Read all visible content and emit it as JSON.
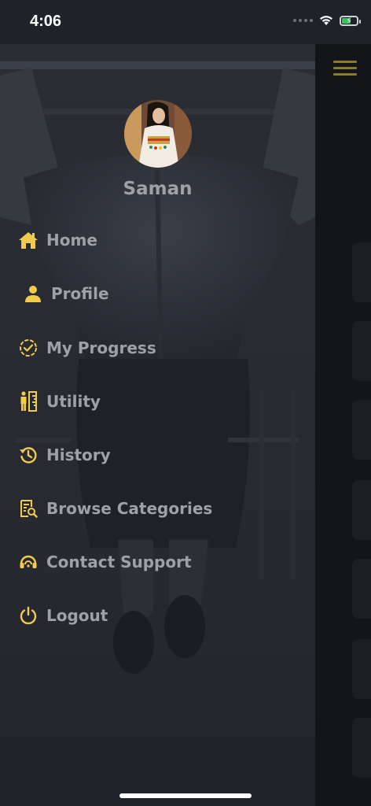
{
  "status_bar": {
    "time": "4:06",
    "battery_level": 0.6
  },
  "user": {
    "name": "Saman"
  },
  "nav": {
    "items": [
      {
        "label": "Home",
        "icon": "home-icon"
      },
      {
        "label": "Profile",
        "icon": "person-icon"
      },
      {
        "label": "My Progress",
        "icon": "progress-check-icon"
      },
      {
        "label": "Utility",
        "icon": "height-measure-icon"
      },
      {
        "label": "History",
        "icon": "history-icon"
      },
      {
        "label": "Browse Categories",
        "icon": "browse-categories-icon"
      },
      {
        "label": "Contact Support",
        "icon": "support-headset-icon"
      },
      {
        "label": "Logout",
        "icon": "power-icon"
      }
    ]
  },
  "colors": {
    "accent": "#f2cb4c",
    "menu_text": "#9ea1a6",
    "drawer_bg": "#23262d",
    "hamburger": "#8c7a2c"
  }
}
